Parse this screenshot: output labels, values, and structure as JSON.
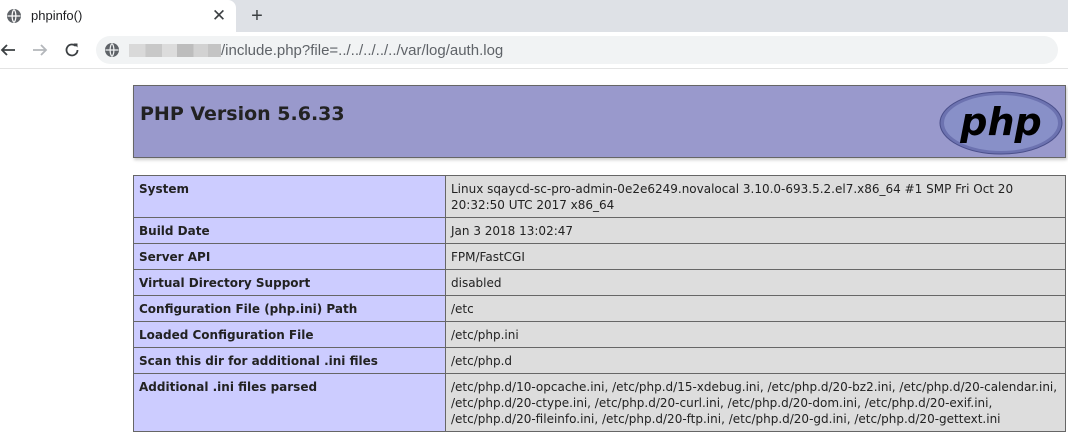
{
  "browser": {
    "tab_title": "phpinfo()",
    "close_glyph": "✕",
    "newtab_glyph": "+",
    "url_path": "/include.php?file=../../../../../var/log/auth.log"
  },
  "header": {
    "title": "PHP Version 5.6.33",
    "logo_text": "php"
  },
  "rows": [
    {
      "label": "System",
      "value": "Linux sqaycd-sc-pro-admin-0e2e6249.novalocal 3.10.0-693.5.2.el7.x86_64 #1 SMP Fri Oct 20 20:32:50 UTC 2017 x86_64"
    },
    {
      "label": "Build Date",
      "value": "Jan 3 2018 13:02:47"
    },
    {
      "label": "Server API",
      "value": "FPM/FastCGI"
    },
    {
      "label": "Virtual Directory Support",
      "value": "disabled"
    },
    {
      "label": "Configuration File (php.ini) Path",
      "value": "/etc"
    },
    {
      "label": "Loaded Configuration File",
      "value": "/etc/php.ini"
    },
    {
      "label": "Scan this dir for additional .ini files",
      "value": "/etc/php.d"
    },
    {
      "label": "Additional .ini files parsed",
      "value": "/etc/php.d/10-opcache.ini, /etc/php.d/15-xdebug.ini, /etc/php.d/20-bz2.ini, /etc/php.d/20-calendar.ini, /etc/php.d/20-ctype.ini, /etc/php.d/20-curl.ini, /etc/php.d/20-dom.ini, /etc/php.d/20-exif.ini, /etc/php.d/20-fileinfo.ini, /etc/php.d/20-ftp.ini, /etc/php.d/20-gd.ini, /etc/php.d/20-gettext.ini"
    }
  ],
  "colors": {
    "header_bg": "#9999cc",
    "label_bg": "#ccccff",
    "value_bg": "#dddddd"
  }
}
